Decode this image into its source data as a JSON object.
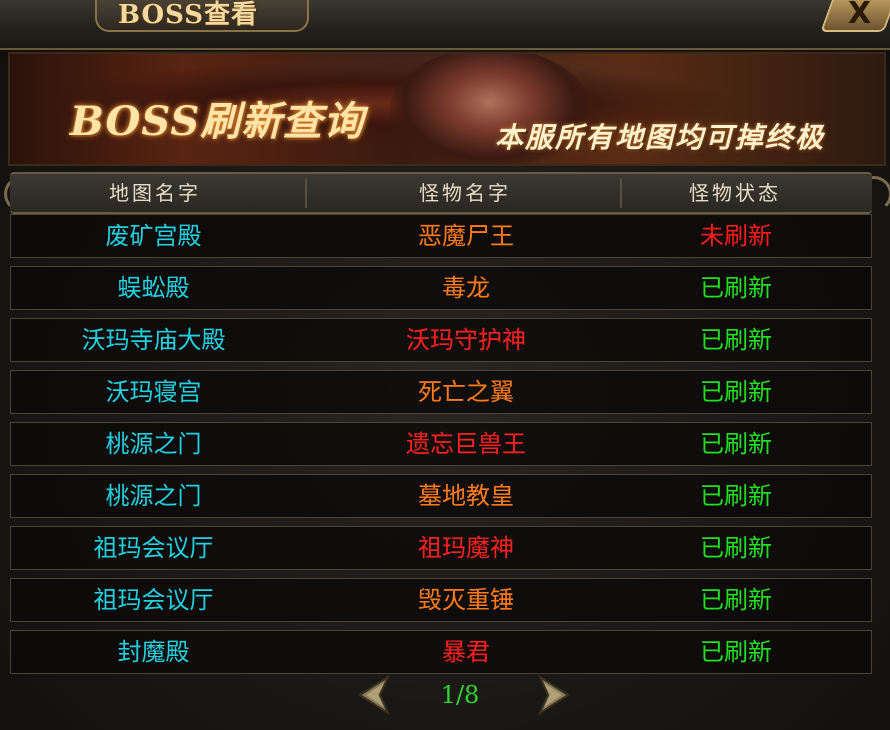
{
  "window": {
    "title": "BOSS查看",
    "close_label": "X"
  },
  "banner": {
    "title": "BOSS刷新查询",
    "subtitle": "本服所有地图均可掉终极"
  },
  "table": {
    "headers": [
      "地图名字",
      "怪物名字",
      "怪物状态"
    ],
    "rows": [
      {
        "map": "废矿宫殿",
        "monster": "恶魔尸王",
        "status": "未刷新",
        "monster_color": "#ff7a1a",
        "status_color": "#ff1a1a"
      },
      {
        "map": "蜈蚣殿",
        "monster": "毒龙",
        "status": "已刷新",
        "monster_color": "#ff7a1a",
        "status_color": "#22e022"
      },
      {
        "map": "沃玛寺庙大殿",
        "monster": "沃玛守护神",
        "status": "已刷新",
        "monster_color": "#ff2020",
        "status_color": "#22e022"
      },
      {
        "map": "沃玛寝宫",
        "monster": "死亡之翼",
        "status": "已刷新",
        "monster_color": "#ff7a1a",
        "status_color": "#22e022"
      },
      {
        "map": "桃源之门",
        "monster": "遗忘巨兽王",
        "status": "已刷新",
        "monster_color": "#ff2020",
        "status_color": "#22e022"
      },
      {
        "map": "桃源之门",
        "monster": "墓地教皇",
        "status": "已刷新",
        "monster_color": "#ff7a1a",
        "status_color": "#22e022"
      },
      {
        "map": "祖玛会议厅",
        "monster": "祖玛魔神",
        "status": "已刷新",
        "monster_color": "#ff2020",
        "status_color": "#22e022"
      },
      {
        "map": "祖玛会议厅",
        "monster": "毁灭重锤",
        "status": "已刷新",
        "monster_color": "#ff7a1a",
        "status_color": "#22e022"
      },
      {
        "map": "封魔殿",
        "monster": "暴君",
        "status": "已刷新",
        "monster_color": "#ff2020",
        "status_color": "#22e022"
      }
    ],
    "map_color": "#22d0e0"
  },
  "pagination": {
    "page_text": "1/8",
    "prev_icon": "arrow-left-icon",
    "next_icon": "arrow-right-icon"
  }
}
